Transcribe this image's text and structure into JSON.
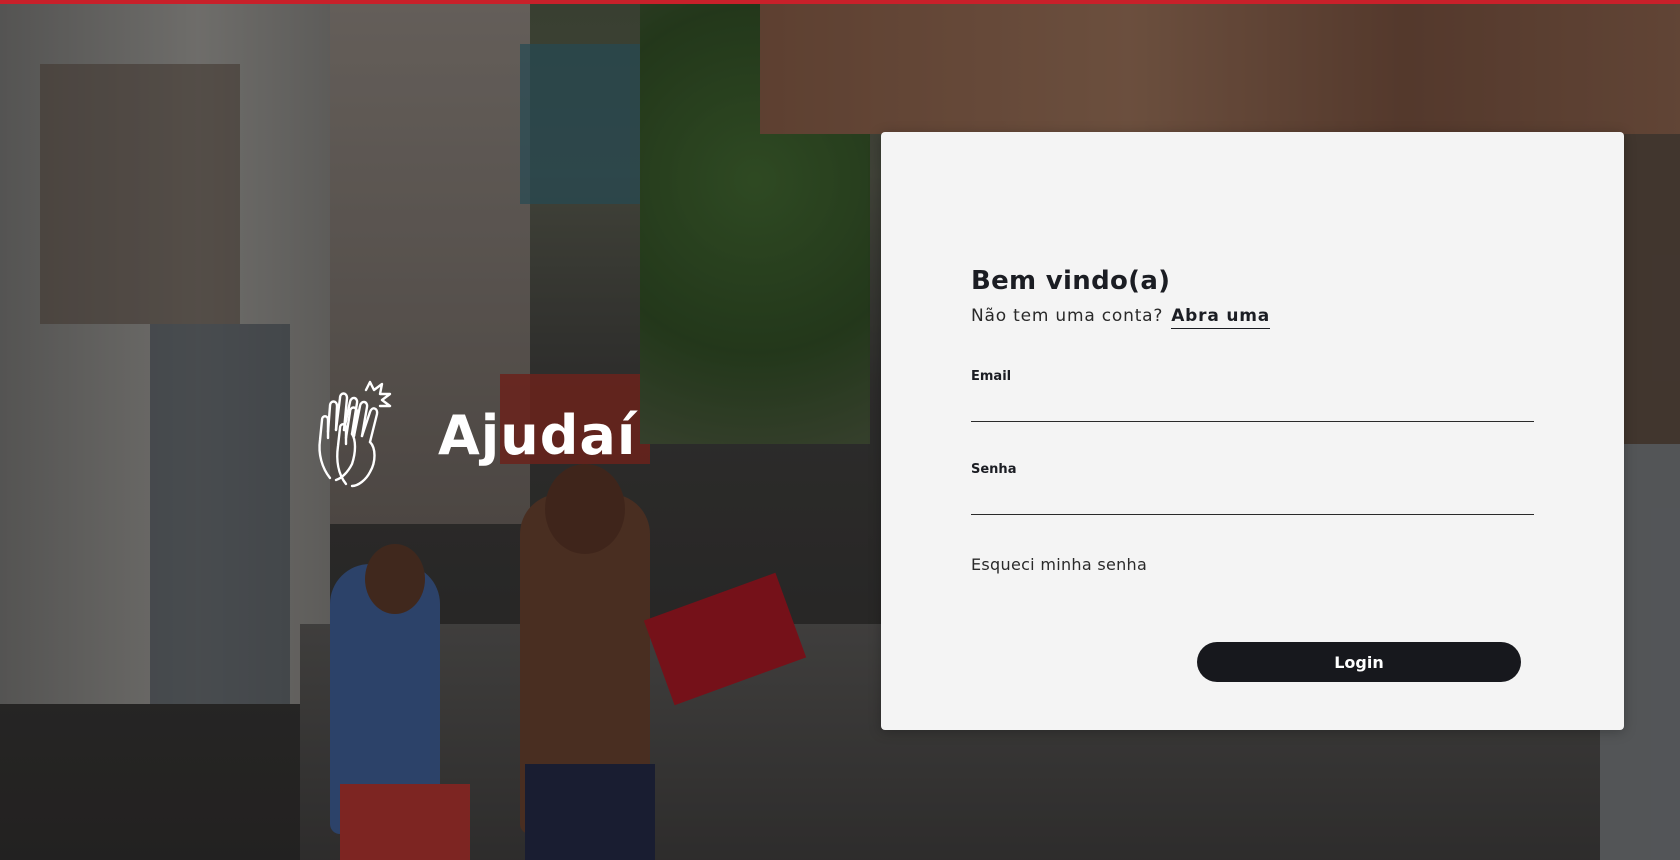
{
  "brand": {
    "name": "Ajudaí",
    "icon": "high-five-hands-icon"
  },
  "login_card": {
    "title": "Bem vindo(a)",
    "signup_prompt": "Não tem uma conta?",
    "signup_link": "Abra uma",
    "email_label": "Email",
    "email_value": "",
    "password_label": "Senha",
    "password_value": "",
    "forgot_password": "Esqueci minha senha",
    "login_button": "Login"
  },
  "colors": {
    "accent_bar": "#c8202a",
    "card_background": "#f4f4f4",
    "button_background": "#17181d",
    "text_dark": "#1b1d23"
  }
}
